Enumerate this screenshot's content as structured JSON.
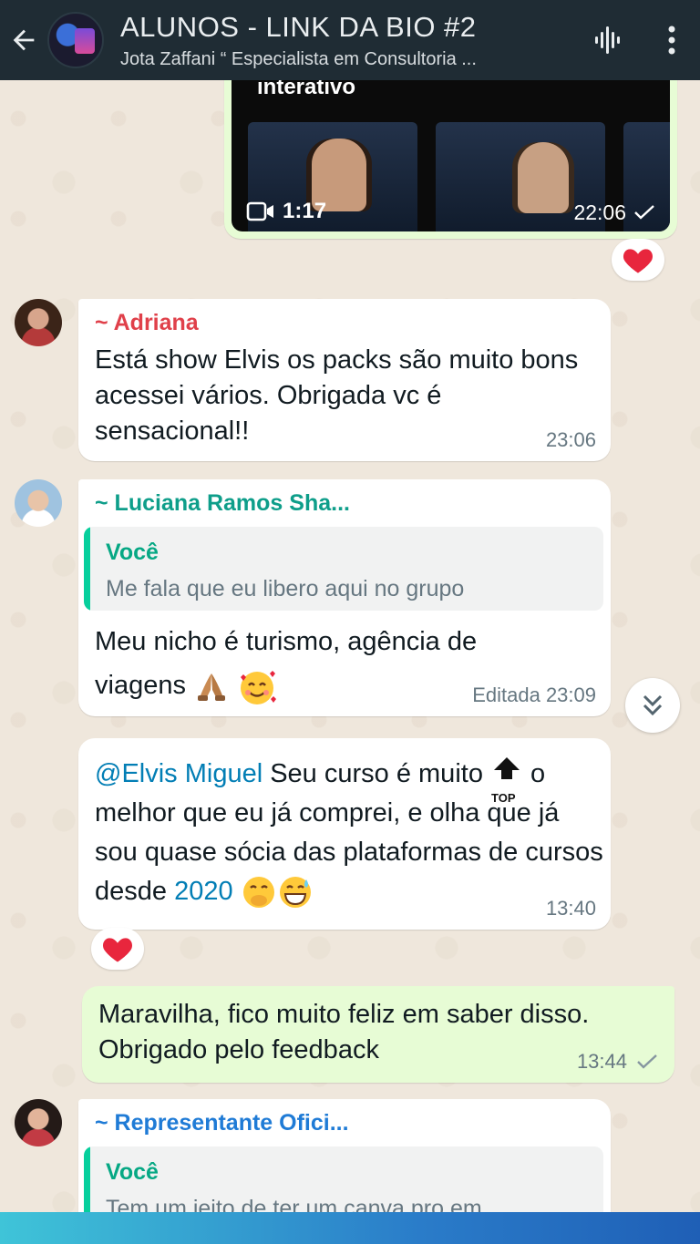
{
  "header": {
    "title": "ALUNOS - LINK DA BIO  #2",
    "subtitle": "Jota Zaffani “ Especialista em Consultoria ..."
  },
  "video_message": {
    "overlay_text": "interativo",
    "duration": "1:17",
    "time": "22:06"
  },
  "messages": {
    "m1": {
      "sender": "~ Adriana",
      "text": "Está show Elvis os packs são muito bons acessei vários. Obrigada vc é sensacional!!",
      "time": "23:06"
    },
    "m2": {
      "sender": "~ Luciana Ramos Sha...",
      "quote_name": "Você",
      "quote_text": "Me fala que eu libero aqui no grupo",
      "text": "Meu nicho é turismo, agência de viagens",
      "time": "Editada 23:09"
    },
    "m3": {
      "mention": "@Elvis Miguel",
      "text_1": " Seu curso é muito ",
      "top_label": "TOP",
      "text_2": " o melhor que eu já comprei, e olha que já sou quase sócia das plataformas de cursos desde ",
      "year": "2020",
      "time": "13:40"
    },
    "m4": {
      "text": "Maravilha, fico muito feliz em saber disso. Obrigado pelo feedback",
      "time": "13:44"
    },
    "m5": {
      "sender": "~ Representante Ofici...",
      "quote_name": "Você",
      "quote_text": "Tem um jeito de ter um canva pro em"
    }
  },
  "colors": {
    "header_bg": "#1f2c34",
    "outgoing_bubble": "#e7fcd5",
    "sender_adriana": "#e0404a",
    "sender_teal": "#0e9e8a",
    "sender_blue": "#1f7bd6"
  }
}
